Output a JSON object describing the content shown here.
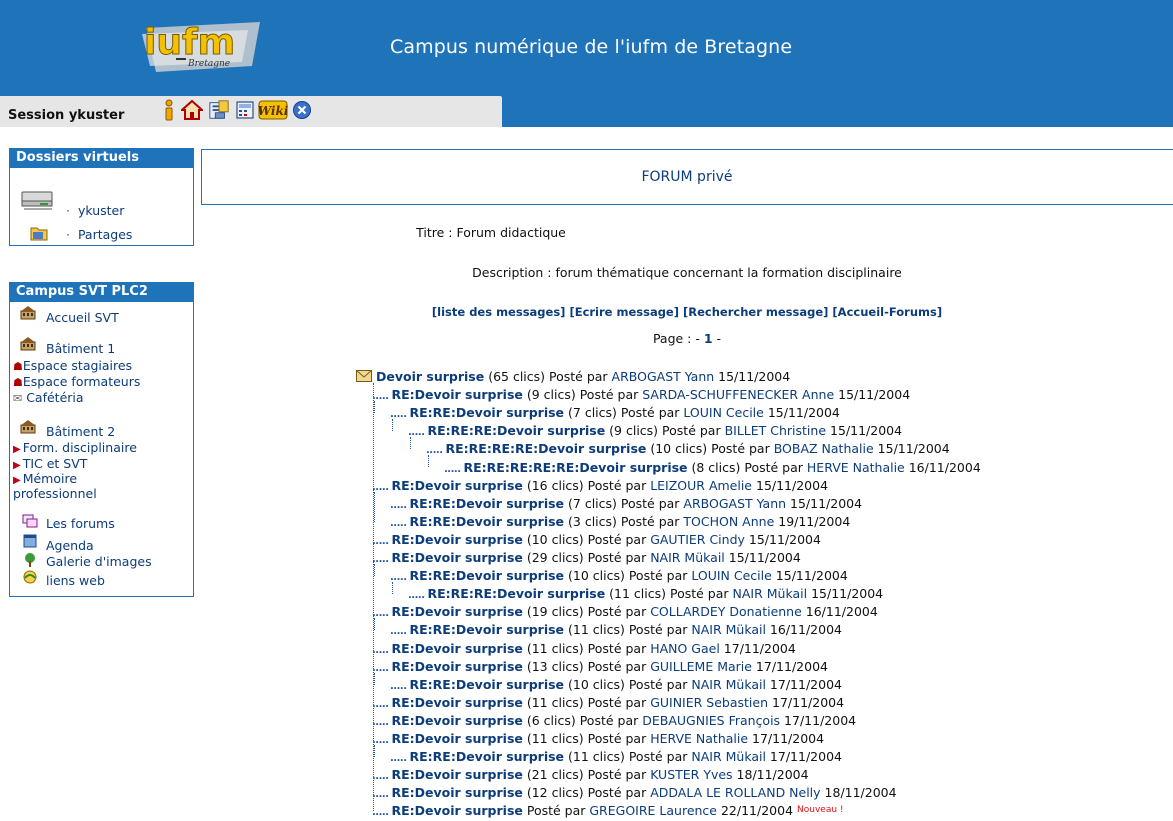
{
  "header": {
    "logo_text": "iufm",
    "logo_subtext": "Bretagne",
    "site_title": "Campus numérique de l'iufm de Bretagne",
    "session_label": "Session ykuster"
  },
  "toolbar_icons": [
    "info-icon",
    "home-icon",
    "documents-icon",
    "calculator-icon",
    "wiki-icon",
    "close-icon"
  ],
  "toolbar_wiki_label": "Wiki",
  "sidebar": {
    "dossiers": {
      "title": "Dossiers virtuels",
      "items": [
        {
          "label": "ykuster",
          "icon": "server-icon"
        },
        {
          "label": "Partages",
          "icon": "folder-icon"
        }
      ]
    },
    "campus": {
      "title": "Campus SVT PLC2",
      "accueil": "Accueil SVT",
      "batiment1": "Bâtiment 1",
      "batiment1_items": [
        "Espace stagiaires",
        "Espace formateurs",
        "Cafétéria"
      ],
      "batiment2": "Bâtiment 2",
      "batiment2_items": [
        "Form. disciplinaire",
        "TIC et SVT",
        "Mémoire",
        "professionnel"
      ],
      "tools": [
        "Les forums",
        "Agenda",
        "Galerie d'images",
        "liens web"
      ]
    }
  },
  "main": {
    "forum_title": "FORUM privé",
    "titre": "Titre : Forum didactique",
    "description": "Description : forum thématique concernant la formation disciplinaire",
    "nav_links": [
      "[liste des messages]",
      "[Ecrire message]",
      "[Rechercher message]",
      "[Accueil-Forums]"
    ],
    "page_prefix": "Page : -",
    "page_number": "1",
    "page_suffix": "-",
    "posted_by": "Posté par",
    "new_badge": "Nouveau !"
  },
  "threads": [
    {
      "level": 0,
      "subject": "Devoir surprise",
      "clics": "(65 clics)",
      "author": "ARBOGAST Yann",
      "date": "15/11/2004"
    },
    {
      "level": 1,
      "subject": "RE:Devoir surprise",
      "clics": "(9 clics)",
      "author": "SARDA-SCHUFFENECKER Anne",
      "date": "15/11/2004"
    },
    {
      "level": 2,
      "subject": "RE:RE:Devoir surprise",
      "clics": "(7 clics)",
      "author": "LOUIN Cecile",
      "date": "15/11/2004"
    },
    {
      "level": 3,
      "subject": "RE:RE:RE:Devoir surprise",
      "clics": "(9 clics)",
      "author": "BILLET Christine",
      "date": "15/11/2004"
    },
    {
      "level": 4,
      "subject": "RE:RE:RE:RE:Devoir surprise",
      "clics": "(10 clics)",
      "author": "BOBAZ Nathalie",
      "date": "15/11/2004"
    },
    {
      "level": 5,
      "subject": "RE:RE:RE:RE:RE:Devoir surprise",
      "clics": "(8 clics)",
      "author": "HERVE Nathalie",
      "date": "16/11/2004"
    },
    {
      "level": 1,
      "subject": "RE:Devoir surprise",
      "clics": "(16 clics)",
      "author": "LEIZOUR Amelie",
      "date": "15/11/2004"
    },
    {
      "level": 2,
      "subject": "RE:RE:Devoir surprise",
      "clics": "(7 clics)",
      "author": "ARBOGAST Yann",
      "date": "15/11/2004"
    },
    {
      "level": 2,
      "subject": "RE:RE:Devoir surprise",
      "clics": "(3 clics)",
      "author": "TOCHON Anne",
      "date": "19/11/2004"
    },
    {
      "level": 1,
      "subject": "RE:Devoir surprise",
      "clics": "(10 clics)",
      "author": "GAUTIER Cindy",
      "date": "15/11/2004"
    },
    {
      "level": 1,
      "subject": "RE:Devoir surprise",
      "clics": "(29 clics)",
      "author": "NAIR Mükail",
      "date": "15/11/2004"
    },
    {
      "level": 2,
      "subject": "RE:RE:Devoir surprise",
      "clics": "(10 clics)",
      "author": "LOUIN Cecile",
      "date": "15/11/2004"
    },
    {
      "level": 3,
      "subject": "RE:RE:RE:Devoir surprise",
      "clics": "(11 clics)",
      "author": "NAIR Mükail",
      "date": "15/11/2004"
    },
    {
      "level": 1,
      "subject": "RE:Devoir surprise",
      "clics": "(19 clics)",
      "author": "COLLARDEY Donatienne",
      "date": "16/11/2004"
    },
    {
      "level": 2,
      "subject": "RE:RE:Devoir surprise",
      "clics": "(11 clics)",
      "author": "NAIR Mükail",
      "date": "16/11/2004"
    },
    {
      "level": 1,
      "subject": "RE:Devoir surprise",
      "clics": "(11 clics)",
      "author": "HANO Gael",
      "date": "17/11/2004"
    },
    {
      "level": 1,
      "subject": "RE:Devoir surprise",
      "clics": "(13 clics)",
      "author": "GUILLEME Marie",
      "date": "17/11/2004"
    },
    {
      "level": 2,
      "subject": "RE:RE:Devoir surprise",
      "clics": "(10 clics)",
      "author": "NAIR Mükail",
      "date": "17/11/2004"
    },
    {
      "level": 1,
      "subject": "RE:Devoir surprise",
      "clics": "(11 clics)",
      "author": "GUINIER Sebastien",
      "date": "17/11/2004"
    },
    {
      "level": 1,
      "subject": "RE:Devoir surprise",
      "clics": "(6 clics)",
      "author": "DEBAUGNIES François",
      "date": "17/11/2004"
    },
    {
      "level": 1,
      "subject": "RE:Devoir surprise",
      "clics": "(11 clics)",
      "author": "HERVE Nathalie",
      "date": "17/11/2004"
    },
    {
      "level": 2,
      "subject": "RE:RE:Devoir surprise",
      "clics": "(11 clics)",
      "author": "NAIR Mükail",
      "date": "17/11/2004"
    },
    {
      "level": 1,
      "subject": "RE:Devoir surprise",
      "clics": "(21 clics)",
      "author": "KUSTER Yves",
      "date": "18/11/2004"
    },
    {
      "level": 1,
      "subject": "RE:Devoir surprise",
      "clics": "(12 clics)",
      "author": "ADDALA LE ROLLAND Nelly",
      "date": "18/11/2004"
    },
    {
      "level": 1,
      "subject": "RE:Devoir surprise",
      "clics": "",
      "author": "GREGOIRE Laurence",
      "date": "22/11/2004",
      "is_new": true
    }
  ]
}
